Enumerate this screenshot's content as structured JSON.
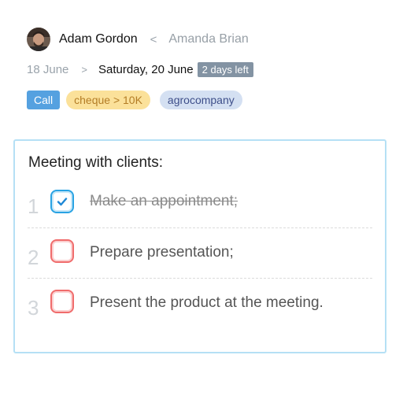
{
  "header": {
    "owner_name": "Adam Gordon",
    "separator": "<",
    "assignee_name": "Amanda Brian"
  },
  "dates": {
    "from": "18 June",
    "arrow": ">",
    "to": "Saturday, 20 June",
    "badge": "2 days left"
  },
  "tags": [
    {
      "label": "Call"
    },
    {
      "label": "cheque > 10K"
    },
    {
      "label": "agrocompany"
    }
  ],
  "card": {
    "title": "Meeting with clients:",
    "tasks": [
      {
        "num": "1",
        "text": "Make an appointment;",
        "done": true
      },
      {
        "num": "2",
        "text": "Prepare presentation;",
        "done": false
      },
      {
        "num": "3",
        "text": "Present the product at the meeting.",
        "done": false
      }
    ]
  },
  "icons": {
    "avatar": "user-avatar",
    "check": "check-icon"
  },
  "colors": {
    "checked": "#29a3e3",
    "unchecked": "#f06c6c",
    "call_tag": "#55a1e0",
    "cheque_tag": "#fbe19a",
    "company_tag": "#d4e0f2",
    "badge": "#8393a3",
    "card_border": "#b5e0f5"
  }
}
